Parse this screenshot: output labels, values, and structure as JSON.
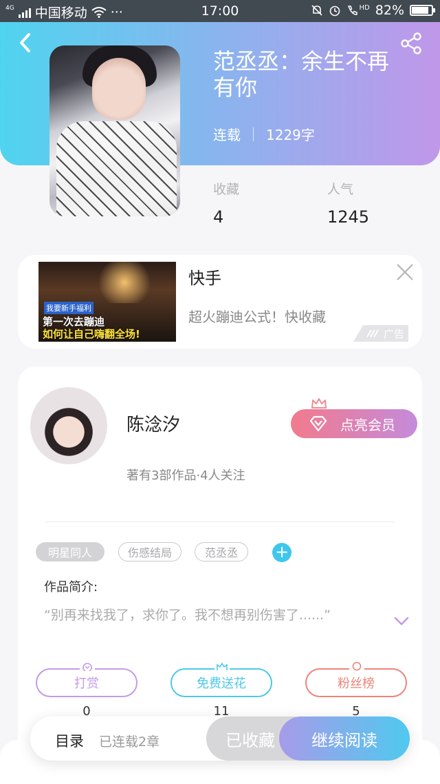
{
  "status_bar": {
    "network_type": "4G",
    "carrier": "中国移动",
    "dots": "···",
    "time": "17:00",
    "hd_label": "HD",
    "battery_percent": "82%",
    "battery_level": 0.82,
    "icons": [
      "signal-icon",
      "wifi-icon",
      "mute-bell-icon",
      "alarm-icon",
      "call-icon",
      "battery-icon"
    ]
  },
  "header": {
    "back_icon": "chevron-left-icon",
    "share_icon": "share-icon",
    "gradient": [
      "#4fd4ef",
      "#c197ea"
    ]
  },
  "book": {
    "title": "范丞丞：余生不再有你",
    "status": "连载",
    "word_count": "1229字",
    "stats": [
      {
        "label": "收藏",
        "value": "4"
      },
      {
        "label": "人气",
        "value": "1245"
      }
    ]
  },
  "ad": {
    "title": "快手",
    "description": "超火蹦迪公式！快收藏",
    "badge": "广告",
    "thumb_caption_1": "我要新手福利",
    "thumb_caption_2": "第一次去蹦迪",
    "thumb_caption_3": "如何让自己嗨翻全场!",
    "close_icon": "close-icon"
  },
  "author": {
    "name": "陈淰汐",
    "stats": "著有3部作品·4人关注",
    "vip_button": "点亮会员",
    "vip_colors": [
      "#f27a8d",
      "#c48bdb"
    ]
  },
  "tags": [
    {
      "label": "明星同人",
      "active": true
    },
    {
      "label": "伤感结局",
      "active": false
    },
    {
      "label": "范丞丞",
      "active": false
    }
  ],
  "add_tag_label": "+",
  "summary": {
    "label": "作品简介:",
    "text": "“别再来找我了，求你了。我不想再别伤害了......”"
  },
  "actions": [
    {
      "label": "打赏",
      "count": "0",
      "color": "#c49be6"
    },
    {
      "label": "免费送花",
      "count": "11",
      "color": "#4cc8e9"
    },
    {
      "label": "粉丝榜",
      "count": "5",
      "color": "#ec8478"
    }
  ],
  "bottom_bar": {
    "toc_label": "目录",
    "toc_info": "已连载2章",
    "favorited_label": "已收藏",
    "read_label": "继续阅读"
  }
}
